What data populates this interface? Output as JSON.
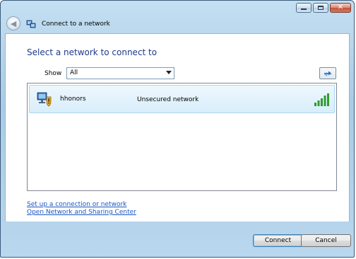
{
  "window": {
    "title": "Connect to a network",
    "caption_buttons": [
      "minimize-icon",
      "maximize-icon",
      "close-icon"
    ]
  },
  "header": {
    "instruction": "Select a network to connect to"
  },
  "filter": {
    "label": "Show",
    "selected": "All"
  },
  "networks": [
    {
      "name": "hhonors",
      "security": "Unsecured network",
      "icon": "unsecured-network-icon",
      "signal_strength": 5,
      "signal_max": 5
    }
  ],
  "links": {
    "setup": "Set up a connection or network",
    "sharing_center": "Open Network and Sharing Center"
  },
  "buttons": {
    "connect": "Connect",
    "cancel": "Cancel"
  },
  "colors": {
    "instruction_text": "#1e3a8a",
    "link": "#1a56c4",
    "selected_row": "#d8eefb",
    "signal": "#2e9b2e"
  }
}
